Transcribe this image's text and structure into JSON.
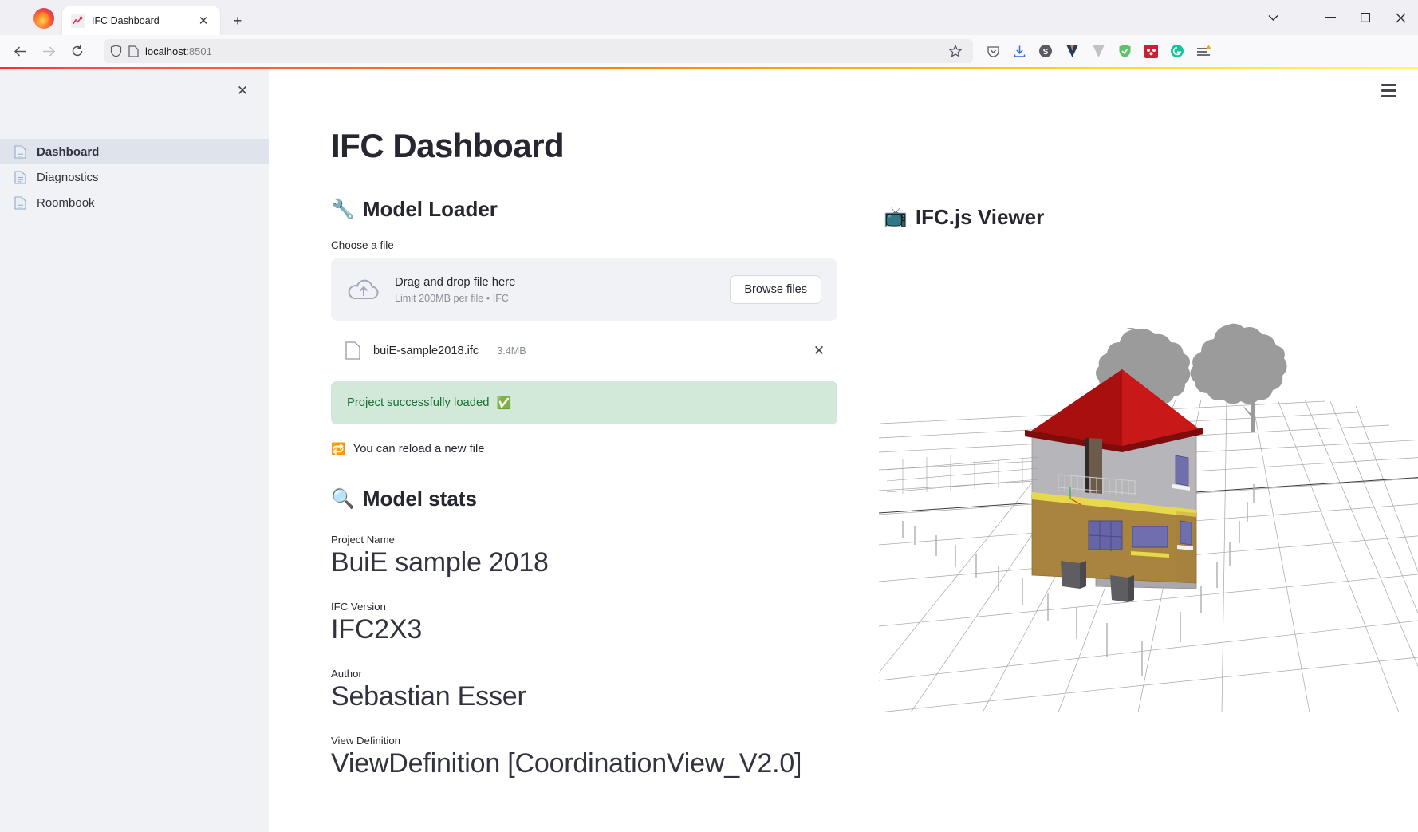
{
  "browser": {
    "tab": {
      "title": "IFC Dashboard",
      "favicon": "chart-line-icon"
    },
    "new_tab_label": "+",
    "tab_close_label": "✕",
    "window_controls": {
      "list_all_tabs": "∨",
      "minimize": "—",
      "maximize": "□",
      "close": "✕"
    },
    "nav": {
      "back": "←",
      "forward": "→",
      "reload": "↻"
    },
    "url": {
      "host": "localhost",
      "port": ":8501"
    },
    "extensions": [
      {
        "name": "pocket-icon",
        "glyph": ""
      },
      {
        "name": "downloads-icon",
        "glyph": ""
      },
      {
        "name": "extension-s-icon",
        "glyph": "S"
      },
      {
        "name": "extension-v-blue-icon",
        "glyph": ""
      },
      {
        "name": "extension-v-grey-icon",
        "glyph": ""
      },
      {
        "name": "extension-shield-green-icon",
        "glyph": ""
      },
      {
        "name": "extension-red-icon",
        "glyph": ""
      },
      {
        "name": "grammarly-icon",
        "glyph": "G"
      },
      {
        "name": "app-menu-icon",
        "glyph": ""
      }
    ]
  },
  "sidebar": {
    "close_label": "✕",
    "items": [
      {
        "label": "Dashboard",
        "icon": "document-icon",
        "active": true
      },
      {
        "label": "Diagnostics",
        "icon": "document-icon",
        "active": false
      },
      {
        "label": "Roombook",
        "icon": "document-icon",
        "active": false
      }
    ]
  },
  "main": {
    "menu_label": "main-menu",
    "page_title": "IFC Dashboard",
    "model_loader": {
      "emoji": "🔧",
      "heading": "Model Loader",
      "choose_file_label": "Choose a file",
      "dropzone": {
        "main_text": "Drag and drop file here",
        "sub_text": "Limit 200MB per file • IFC",
        "browse_label": "Browse files"
      },
      "uploaded_file": {
        "name": "buiE-sample2018.ifc",
        "size": "3.4MB",
        "remove_label": "✕"
      },
      "success_message": "Project successfully loaded",
      "success_emoji": "✅",
      "reload_emoji": "🔁",
      "reload_text": "You can reload a new file"
    },
    "model_stats": {
      "emoji": "🔍",
      "heading": "Model stats",
      "entries": [
        {
          "label": "Project Name",
          "value": "BuiE sample 2018"
        },
        {
          "label": "IFC Version",
          "value": "IFC2X3"
        },
        {
          "label": "Author",
          "value": "Sebastian Esser"
        },
        {
          "label": "View Definition",
          "value": "ViewDefinition [CoordinationView_V2.0]"
        }
      ]
    },
    "viewer": {
      "emoji": "📺",
      "heading": "IFC.js Viewer",
      "scene": {
        "description": "3D IFC building model on perspective grid",
        "roof_color": "#b91212",
        "upper_wall_color": "#a9a9ad",
        "lower_wall_color": "#a8843f",
        "window_color": "#5a5a9e",
        "tree_color": "#9b9b9b",
        "grid_color": "#9a9a9a"
      }
    }
  },
  "colors": {
    "streamlit_accent": "#ff4b4b",
    "sidebar_bg": "#f0f2f6",
    "sidebar_active_bg": "#dfe3eb",
    "text_primary": "#262730",
    "success_bg": "#d2e8d9",
    "success_text": "#177233"
  }
}
